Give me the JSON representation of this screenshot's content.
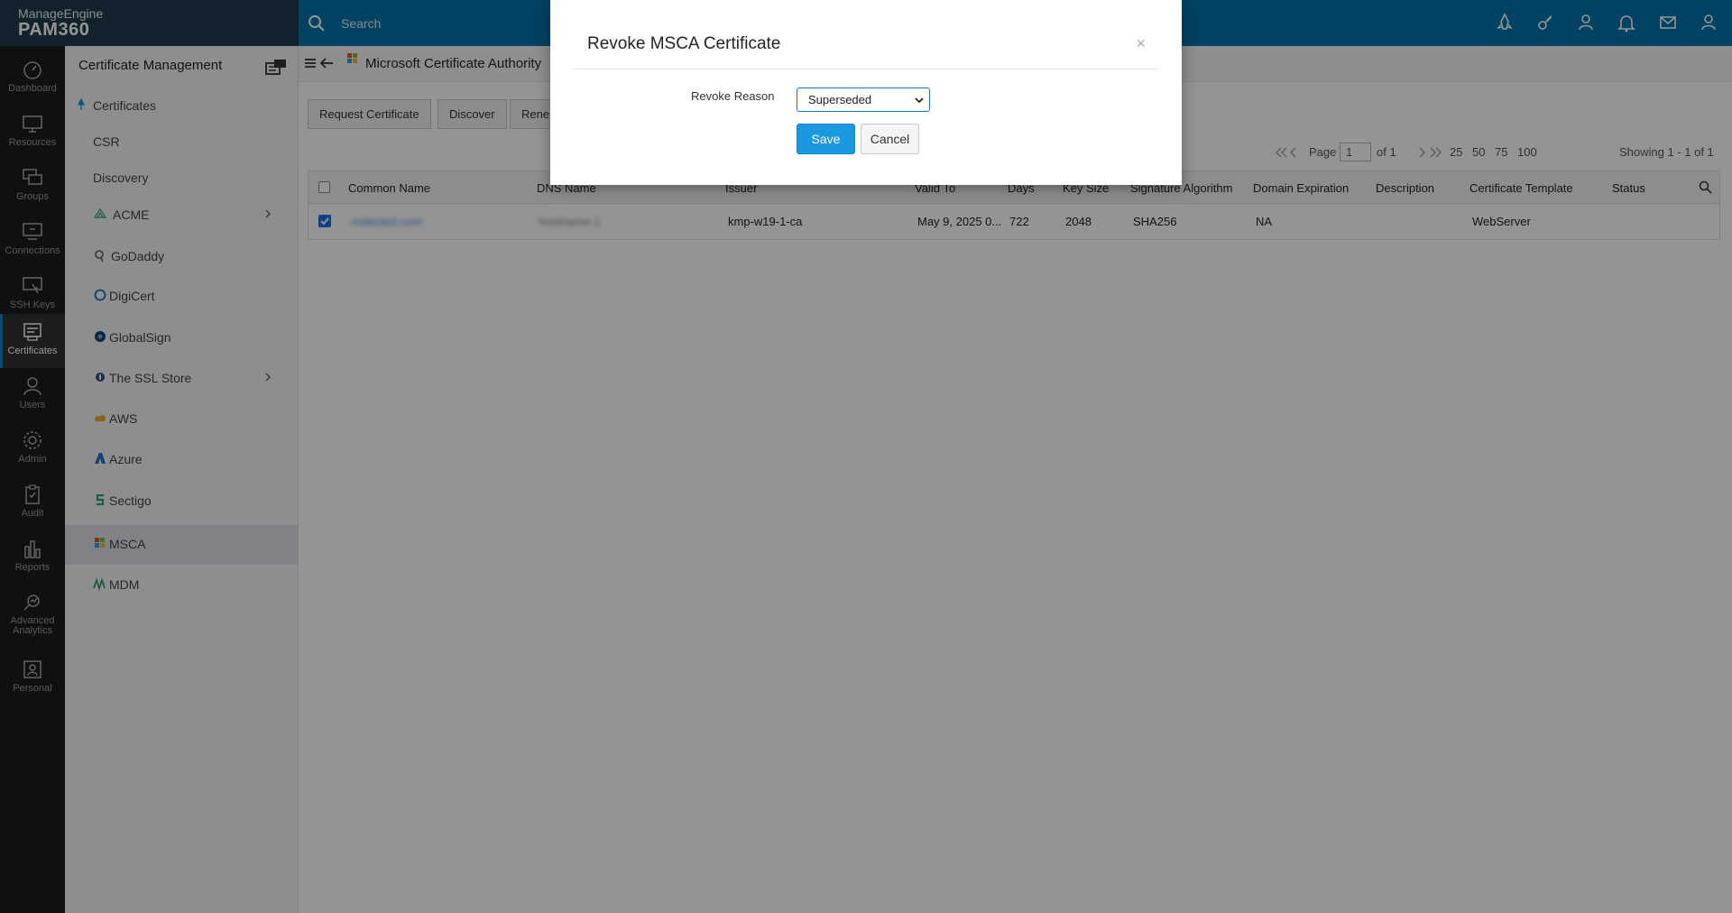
{
  "brand": {
    "vendor": "ManageEngine",
    "product": "PAM360"
  },
  "search": {
    "placeholder": "Search"
  },
  "topbar_icons": [
    "rocket-icon",
    "key-icon",
    "user-settings-icon",
    "bell-icon",
    "mail-icon",
    "user-menu-icon"
  ],
  "leftnav": [
    {
      "label": "Dashboard",
      "icon": "dashboard-icon"
    },
    {
      "label": "Resources",
      "icon": "monitor-icon"
    },
    {
      "label": "Groups",
      "icon": "groups-icon"
    },
    {
      "label": "Connections",
      "icon": "connections-icon"
    },
    {
      "label": "SSH Keys",
      "icon": "ssh-keys-icon"
    },
    {
      "label": "Certificates",
      "icon": "certificate-icon",
      "active": true
    },
    {
      "label": "Users",
      "icon": "user-icon"
    },
    {
      "label": "Admin",
      "icon": "gear-icon"
    },
    {
      "label": "Audit",
      "icon": "clipboard-icon"
    },
    {
      "label": "Reports",
      "icon": "bar-chart-icon"
    },
    {
      "label": "Advanced Analytics",
      "icon": "analytics-icon"
    },
    {
      "label": "Personal",
      "icon": "personal-icon"
    }
  ],
  "sidebar": {
    "title": "Certificate Management",
    "items": [
      {
        "label": "Certificates",
        "icon": "pin-icon"
      },
      {
        "label": "CSR"
      },
      {
        "label": "Discovery"
      },
      {
        "label": "ACME",
        "icon": "acme-icon",
        "expandable": true
      },
      {
        "label": "GoDaddy",
        "icon": "godaddy-icon"
      },
      {
        "label": "DigiCert",
        "icon": "digicert-icon"
      },
      {
        "label": "GlobalSign",
        "icon": "globalsign-icon"
      },
      {
        "label": "The SSL Store",
        "icon": "ssl-store-icon",
        "expandable": true
      },
      {
        "label": "AWS",
        "icon": "aws-icon"
      },
      {
        "label": "Azure",
        "icon": "azure-icon"
      },
      {
        "label": "Sectigo",
        "icon": "sectigo-icon"
      },
      {
        "label": "MSCA",
        "icon": "msca-icon",
        "selected": true
      },
      {
        "label": "MDM",
        "icon": "mdm-icon"
      }
    ]
  },
  "main": {
    "breadcrumb": "Microsoft Certificate Authority",
    "toolbar": {
      "request": "Request Certificate",
      "discover": "Discover",
      "renew": "Rene"
    },
    "pager": {
      "page_label": "Page",
      "page_value": "1",
      "of_label": "of 1",
      "sizes": [
        "25",
        "50",
        "75",
        "100"
      ],
      "showing": "Showing 1 - 1 of 1"
    },
    "columns": [
      "Common Name",
      "DNS Name",
      "Issuer",
      "Valid To",
      "Days",
      "Key Size",
      "Signature Algorithm",
      "Domain Expiration",
      "Description",
      "Certificate Template",
      "Status"
    ],
    "rows": [
      {
        "common_name": "redacted.com",
        "dns_name": "hostname-1",
        "issuer": "kmp-w19-1-ca",
        "valid_to": "May 9, 2025 0...",
        "days": "722",
        "key_size": "2048",
        "sig_alg": "SHA256",
        "domain_exp": "NA",
        "description": "",
        "template": "WebServer",
        "status": ""
      }
    ]
  },
  "modal": {
    "title": "Revoke MSCA Certificate",
    "close": "×",
    "reason_label": "Revoke Reason",
    "reason_value": "Superseded",
    "save": "Save",
    "cancel": "Cancel"
  },
  "colors": {
    "topbar": "#0072a8",
    "nav": "#1d1d1d",
    "accent": "#1a98e0"
  }
}
